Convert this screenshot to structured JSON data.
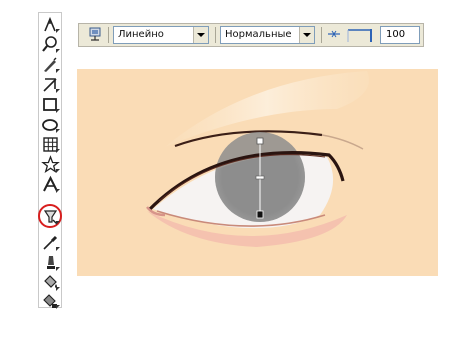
{
  "propbar": {
    "mode_value": "Линейно",
    "blend_value": "Нормальные",
    "transparency_value": "100"
  },
  "toolbox": {
    "tools": [
      {
        "icon": "pick-tool-icon"
      },
      {
        "icon": "zoom-tool-icon"
      },
      {
        "icon": "freehand-tool-icon"
      },
      {
        "icon": "smart-fill-tool-icon"
      },
      {
        "icon": "rectangle-tool-icon"
      },
      {
        "icon": "ellipse-tool-icon"
      },
      {
        "icon": "graph-paper-tool-icon"
      },
      {
        "icon": "star-shape-tool-icon"
      },
      {
        "icon": "text-tool-icon"
      },
      {
        "icon": "transparency-tool-icon",
        "selected": true
      },
      {
        "icon": "eyedropper-tool-icon"
      },
      {
        "icon": "outline-tool-icon"
      },
      {
        "icon": "fill-tool-icon"
      },
      {
        "icon": "interactive-fill-tool-icon"
      }
    ]
  },
  "colors": {
    "canvas_bg": "#fadcb6",
    "selection_ring": "#d81e1e",
    "iris": "#8d8d8d"
  }
}
